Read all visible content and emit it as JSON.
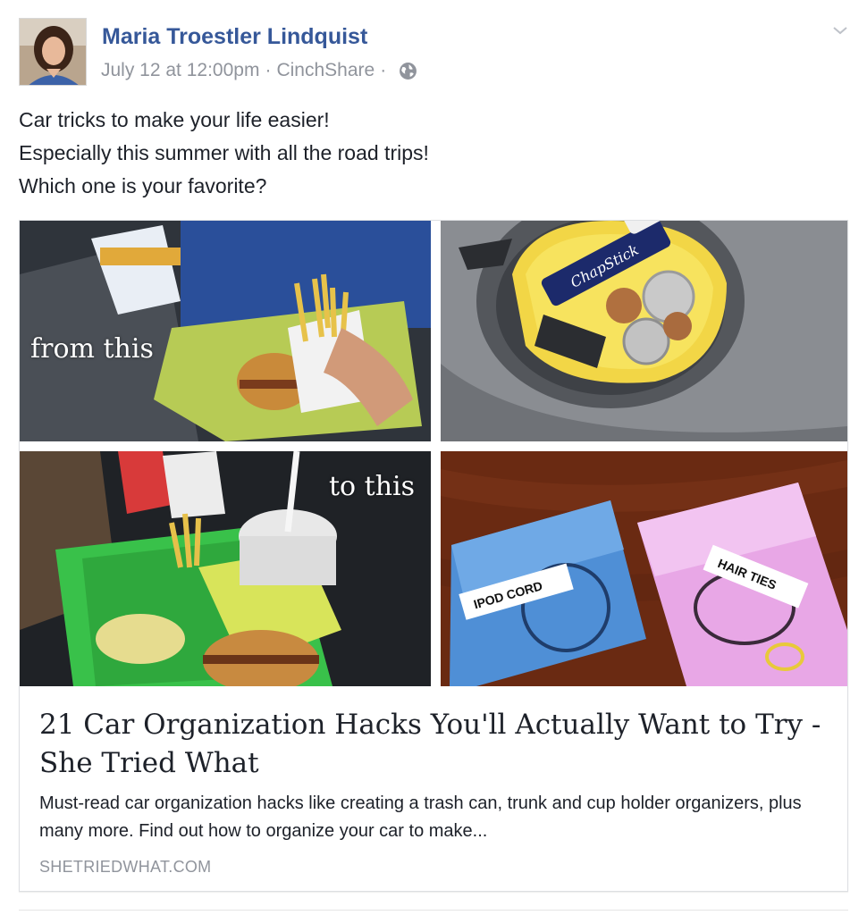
{
  "post": {
    "author": "Maria Troestler Lindquist",
    "timestamp": "July 12 at 12:00pm",
    "separator": "·",
    "via": "CinchShare",
    "audience_icon": "globe-icon",
    "menu_icon": "chevron-down-icon",
    "text_lines": [
      "Car tricks to make your life easier!",
      "Especially this summer with all the road trips!",
      "Which one is your favorite?"
    ]
  },
  "card": {
    "images": {
      "top_left_caption": "from this",
      "bottom_left_caption": "to this",
      "lip_balm_label": "ChapStick",
      "case_label_left": "IPOD CORD",
      "case_label_right": "HAIR TIES"
    },
    "title": "21 Car Organization Hacks You'll Actually Want to Try - She Tried What",
    "description": "Must-read car organization hacks like creating a trash can, trunk and cup holder organizers, plus many more. Find out how to organize your car to make...",
    "domain": "SHETRIEDWHAT.COM"
  },
  "colors": {
    "author_link": "#365899",
    "meta_gray": "#90949c",
    "text": "#1d2129",
    "border": "#dddfe2"
  }
}
